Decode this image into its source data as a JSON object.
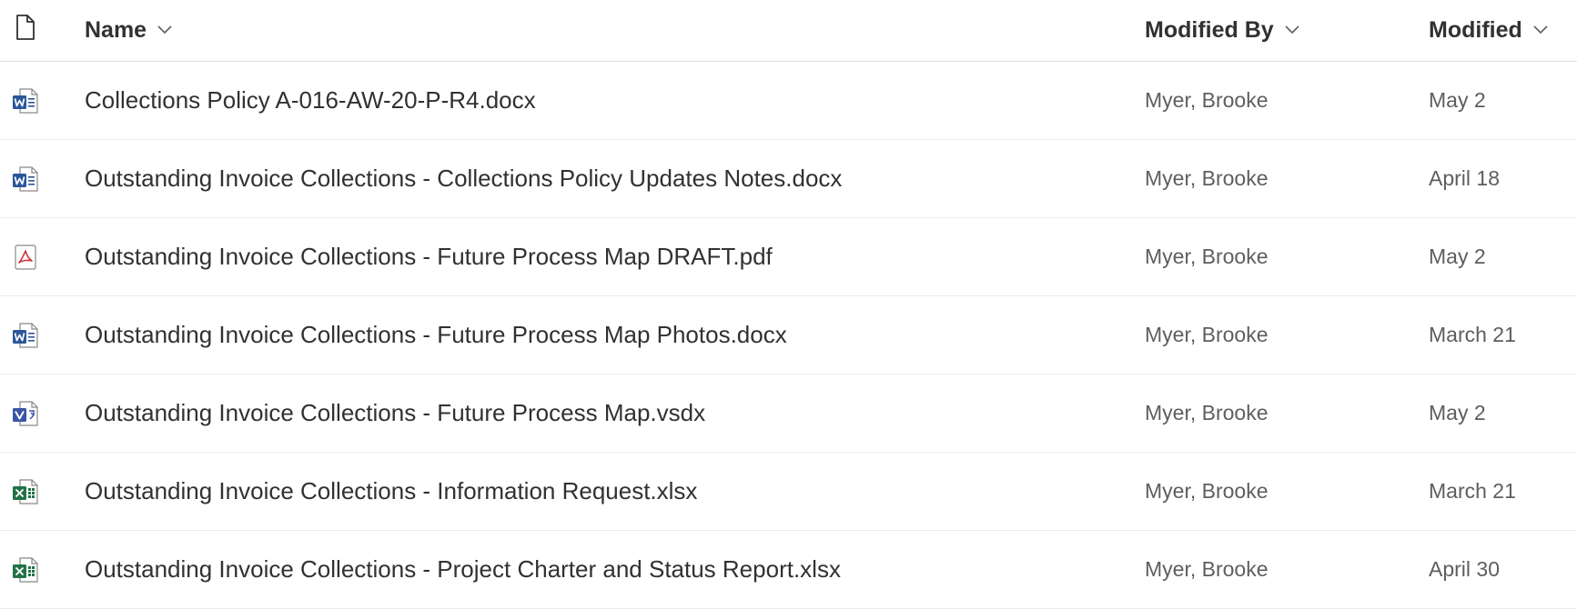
{
  "columns": {
    "name": "Name",
    "modified_by": "Modified By",
    "modified": "Modified"
  },
  "icons": {
    "header": "document-icon",
    "docx": "word-file-icon",
    "pdf": "pdf-file-icon",
    "vsdx": "visio-file-icon",
    "xlsx": "excel-file-icon"
  },
  "colors": {
    "word": "#2b579a",
    "excel": "#217346",
    "visio": "#3955a3",
    "pdf": "#d13438"
  },
  "files": [
    {
      "name": "Collections Policy A-016-AW-20-P-R4.docx",
      "type": "docx",
      "modified_by": "Myer, Brooke",
      "modified": "May 2"
    },
    {
      "name": "Outstanding Invoice Collections - Collections Policy Updates Notes.docx",
      "type": "docx",
      "modified_by": "Myer, Brooke",
      "modified": "April 18"
    },
    {
      "name": "Outstanding Invoice Collections - Future Process Map DRAFT.pdf",
      "type": "pdf",
      "modified_by": "Myer, Brooke",
      "modified": "May 2"
    },
    {
      "name": "Outstanding Invoice Collections - Future Process Map Photos.docx",
      "type": "docx",
      "modified_by": "Myer, Brooke",
      "modified": "March 21"
    },
    {
      "name": "Outstanding Invoice Collections - Future Process Map.vsdx",
      "type": "vsdx",
      "modified_by": "Myer, Brooke",
      "modified": "May 2"
    },
    {
      "name": "Outstanding Invoice Collections - Information Request.xlsx",
      "type": "xlsx",
      "modified_by": "Myer, Brooke",
      "modified": "March 21"
    },
    {
      "name": "Outstanding Invoice Collections - Project Charter and Status Report.xlsx",
      "type": "xlsx",
      "modified_by": "Myer, Brooke",
      "modified": "April 30"
    }
  ]
}
